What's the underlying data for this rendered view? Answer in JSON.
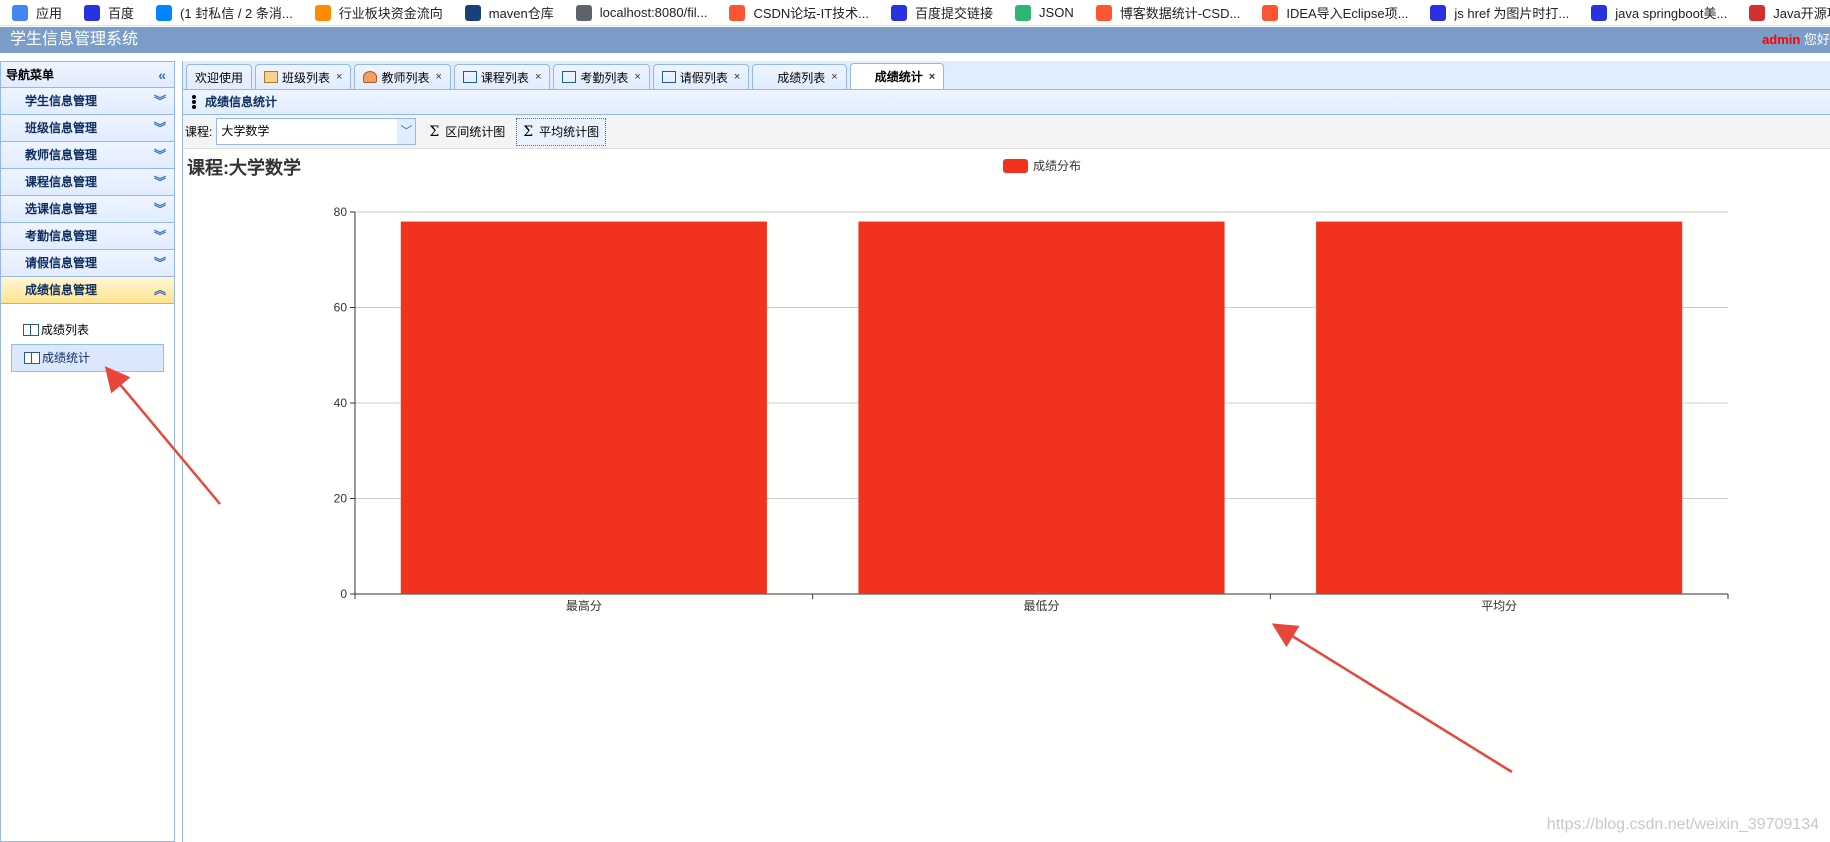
{
  "bookmarks": [
    {
      "label": "应用",
      "icon": "apps-grid-icon",
      "color": "#4285f4"
    },
    {
      "label": "百度",
      "icon": "baidu-paw-icon",
      "color": "#2932e1"
    },
    {
      "label": "(1 封私信 / 2 条消...",
      "icon": "zhihu-icon",
      "color": "#0084ff"
    },
    {
      "label": "行业板块资金流向",
      "icon": "eastmoney-icon",
      "color": "#ff8c00"
    },
    {
      "label": "maven仓库",
      "icon": "mvn-icon",
      "color": "#1a3f7a"
    },
    {
      "label": "localhost:8080/fil...",
      "icon": "globe-icon",
      "color": "#5f6368"
    },
    {
      "label": "CSDN论坛-IT技术...",
      "icon": "csdn-icon",
      "color": "#fc5531"
    },
    {
      "label": "百度提交链接",
      "icon": "baidu-paw-icon",
      "color": "#2932e1"
    },
    {
      "label": "JSON",
      "icon": "json-icon",
      "color": "#2bb673"
    },
    {
      "label": "博客数据统计-CSD...",
      "icon": "csdn-icon",
      "color": "#fc5531"
    },
    {
      "label": "IDEA导入Eclipse项...",
      "icon": "csdn-icon",
      "color": "#fc5531"
    },
    {
      "label": "js href 为图片时打...",
      "icon": "baidu-paw-icon",
      "color": "#2932e1"
    },
    {
      "label": "java springboot美...",
      "icon": "baidu-paw-icon",
      "color": "#2932e1"
    },
    {
      "label": "Java开源项目",
      "icon": "j-icon",
      "color": "#d32f2f"
    }
  ],
  "app": {
    "title": "学生信息管理系统",
    "user": "admin",
    "greeting_partial": " 您好"
  },
  "sidebar": {
    "header": "导航菜单",
    "items": [
      {
        "label": "学生信息管理",
        "expanded": false
      },
      {
        "label": "班级信息管理",
        "expanded": false
      },
      {
        "label": "教师信息管理",
        "expanded": false
      },
      {
        "label": "课程信息管理",
        "expanded": false
      },
      {
        "label": "选课信息管理",
        "expanded": false
      },
      {
        "label": "考勤信息管理",
        "expanded": false
      },
      {
        "label": "请假信息管理",
        "expanded": false
      },
      {
        "label": "成绩信息管理",
        "expanded": true
      }
    ],
    "sub_items": [
      {
        "label": "成绩列表",
        "selected": false
      },
      {
        "label": "成绩统计",
        "selected": true
      }
    ]
  },
  "tabs": [
    {
      "label": "欢迎使用",
      "icon": "",
      "closable": false,
      "active": false
    },
    {
      "label": "班级列表",
      "icon": "home-icon",
      "closable": true,
      "active": false
    },
    {
      "label": "教师列表",
      "icon": "user-icon",
      "closable": true,
      "active": false
    },
    {
      "label": "课程列表",
      "icon": "book-icon",
      "closable": true,
      "active": false
    },
    {
      "label": "考勤列表",
      "icon": "book-icon",
      "closable": true,
      "active": false
    },
    {
      "label": "请假列表",
      "icon": "book-icon",
      "closable": true,
      "active": false
    },
    {
      "label": "成绩列表",
      "icon": "",
      "closable": true,
      "active": false
    },
    {
      "label": "成绩统计",
      "icon": "",
      "closable": true,
      "active": true
    }
  ],
  "panel": {
    "title": "成绩信息统计"
  },
  "toolbar": {
    "course_label": "课程:",
    "course_value": "大学数学",
    "range_button": "区间统计图",
    "avg_button": "平均统计图"
  },
  "course_heading": "课程:大学数学",
  "watermark": "https://blog.csdn.net/weixin_39709134",
  "colors": {
    "bar": "#f0321f",
    "accent": "#95b8e7",
    "annotation_arrow": "#e8453c"
  },
  "chart_data": {
    "type": "bar",
    "categories": [
      "最高分",
      "最低分",
      "平均分"
    ],
    "series": [
      {
        "name": "成绩分布",
        "values": [
          78,
          78,
          78
        ]
      }
    ],
    "yticks": [
      0,
      20,
      40,
      60,
      80
    ],
    "ylim": [
      0,
      80
    ],
    "grid": true,
    "legend": "top-center"
  }
}
